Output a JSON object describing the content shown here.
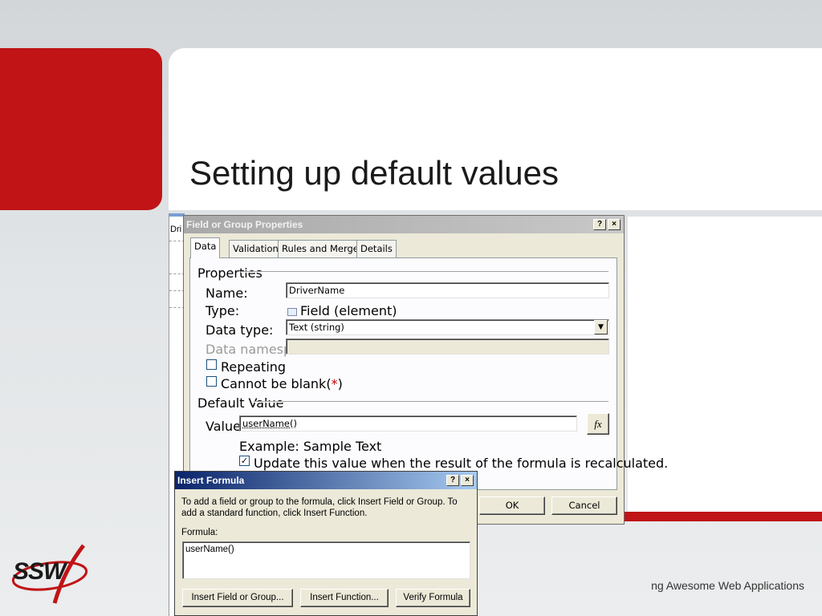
{
  "slide": {
    "title": "Setting up default values",
    "footer": "ng Awesome Web Applications",
    "logo_text": "SSW"
  },
  "background_doc": {
    "text": "Dri"
  },
  "field_dialog": {
    "title": "Field or Group Properties",
    "help_btn": "?",
    "close_btn": "×",
    "tabs": [
      "Data",
      "Validation",
      "Rules and Merge",
      "Details"
    ],
    "properties_group": "Properties",
    "name_label": "Name:",
    "name_value": "DriverName",
    "type_label": "Type:",
    "type_value": "Field (element)",
    "datatype_label": "Data type:",
    "datatype_value": "Text (string)",
    "namespace_label": "Data namespace:",
    "namespace_value": "",
    "repeating_label": "Repeating",
    "cannot_blank_label": "Cannot be blank",
    "required_marker": "*",
    "default_group": "Default Value",
    "value_label": "Value:",
    "value_value": "userName()",
    "fx_label": "fx",
    "example_text": "Example: Sample Text",
    "update_label": "Update this value when the result of the formula is recalculated.",
    "ok_btn": "OK",
    "cancel_btn": "Cancel"
  },
  "formula_dialog": {
    "title": "Insert Formula",
    "help_btn": "?",
    "close_btn": "×",
    "instructions": "To add a field or group to the formula, click Insert Field or Group. To add a standard function, click Insert Function.",
    "formula_label": "Formula:",
    "formula_value": "userName()",
    "insert_field_btn": "Insert Field or Group...",
    "insert_function_btn": "Insert Function...",
    "verify_btn": "Verify Formula"
  },
  "colors": {
    "accent_red": "#c01416",
    "dialog_face": "#ece9d8",
    "active_title": "#0a246a"
  }
}
